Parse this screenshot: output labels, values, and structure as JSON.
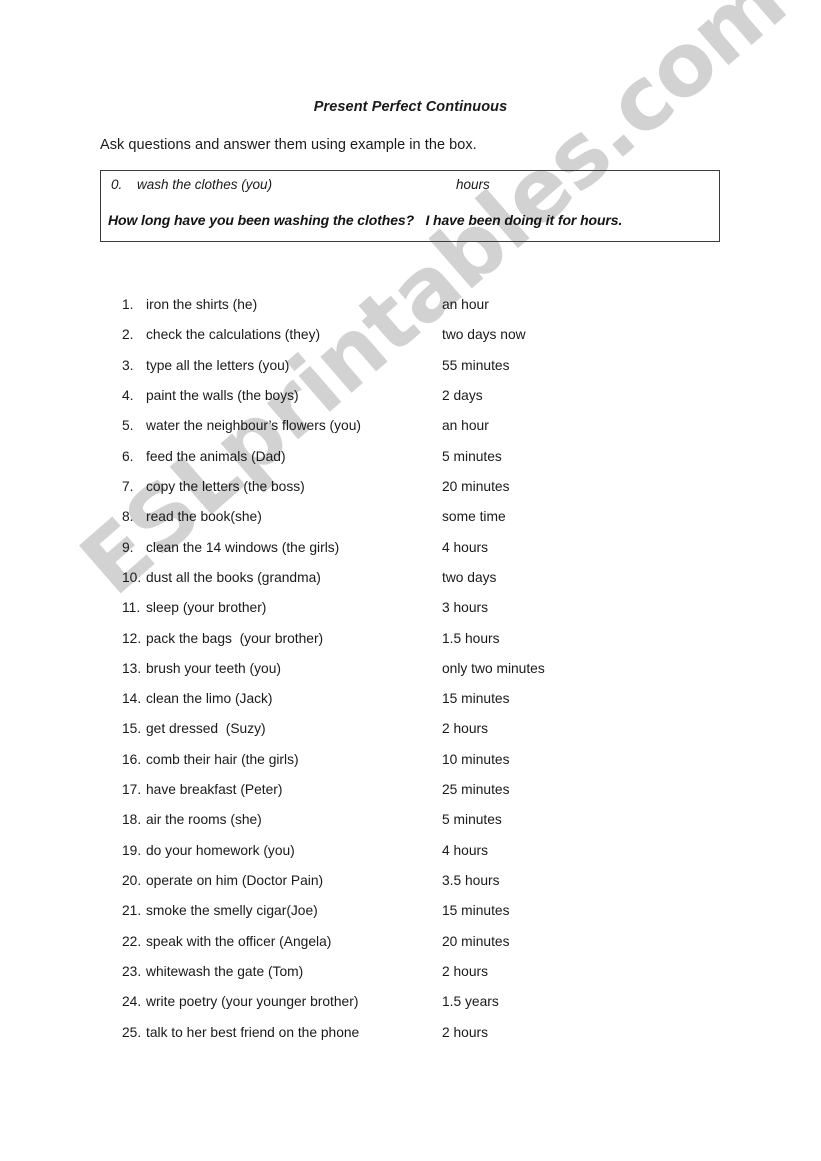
{
  "document": {
    "title": "Present Perfect Continuous",
    "instruction": "Ask questions and answer them using example in the box."
  },
  "watermark": {
    "text": "ESLprintables.com",
    "color": "#d2d2d2"
  },
  "example_box": {
    "number": "0.",
    "task": "wash the clothes (you)",
    "duration": "hours",
    "answer": "How long have you been washing the clothes?   I have been doing it for hours."
  },
  "exercises": [
    {
      "number": "1.",
      "task": "iron the shirts (he)",
      "duration": "an hour"
    },
    {
      "number": "2.",
      "task": "check the calculations (they)",
      "duration": "two days now"
    },
    {
      "number": "3.",
      "task": "type all the letters (you)",
      "duration": "55 minutes"
    },
    {
      "number": "4.",
      "task": "paint the walls (the boys)",
      "duration": "2 days"
    },
    {
      "number": "5.",
      "task": "water the neighbour’s flowers (you)",
      "duration": "an hour"
    },
    {
      "number": "6.",
      "task": "feed the animals (Dad)",
      "duration": "5 minutes"
    },
    {
      "number": "7.",
      "task": "copy the letters (the boss)",
      "duration": "20 minutes"
    },
    {
      "number": "8.",
      "task": "read the book(she)",
      "duration": "some time"
    },
    {
      "number": "9.",
      "task": "clean the 14 windows (the girls)",
      "duration": "4 hours"
    },
    {
      "number": "10.",
      "task": "dust all the books (grandma)",
      "duration": "two days"
    },
    {
      "number": "11.",
      "task": "sleep (your brother)",
      "duration": "3 hours"
    },
    {
      "number": "12.",
      "task": "pack the bags  (your brother)",
      "duration": "1.5 hours"
    },
    {
      "number": "13.",
      "task": "brush your teeth (you)",
      "duration": "only two minutes"
    },
    {
      "number": "14.",
      "task": "clean the limo (Jack)",
      "duration": "15 minutes"
    },
    {
      "number": "15.",
      "task": "get dressed  (Suzy)",
      "duration": "2 hours"
    },
    {
      "number": "16.",
      "task": "comb their hair (the girls)",
      "duration": "10 minutes"
    },
    {
      "number": "17.",
      "task": "have breakfast (Peter)",
      "duration": "25 minutes"
    },
    {
      "number": "18.",
      "task": "air the rooms (she)",
      "duration": "5 minutes"
    },
    {
      "number": "19.",
      "task": "do your homework (you)",
      "duration": "4 hours"
    },
    {
      "number": "20.",
      "task": "operate on him (Doctor Pain)",
      "duration": "3.5 hours"
    },
    {
      "number": "21.",
      "task": "smoke the smelly cigar(Joe)",
      "duration": "15 minutes"
    },
    {
      "number": "22.",
      "task": "speak with the officer (Angela)",
      "duration": "20 minutes"
    },
    {
      "number": "23.",
      "task": "whitewash the gate (Tom)",
      "duration": "2 hours"
    },
    {
      "number": "24.",
      "task": "write poetry (your younger brother)",
      "duration": "1.5 years"
    },
    {
      "number": "25.",
      "task": "talk to her best friend on the phone",
      "duration": "2 hours"
    }
  ]
}
